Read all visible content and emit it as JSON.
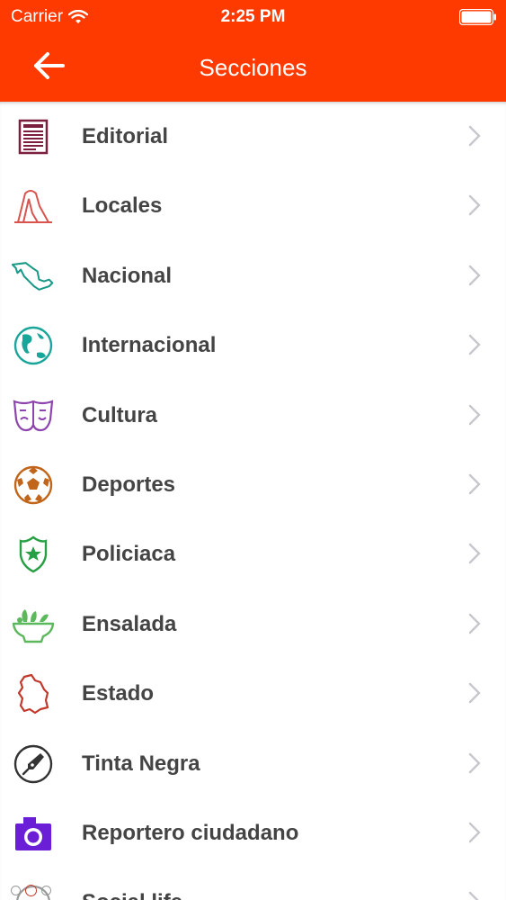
{
  "status_bar": {
    "carrier": "Carrier",
    "time": "2:25 PM"
  },
  "nav": {
    "title": "Secciones",
    "back_icon": "arrow-left-icon"
  },
  "colors": {
    "header_bg": "#fe3a00",
    "label": "#444444",
    "chevron": "#c7c7cc"
  },
  "sections": [
    {
      "label": "Editorial",
      "icon": "newspaper-icon",
      "color": "#7a1f3d"
    },
    {
      "label": "Locales",
      "icon": "monument-icon",
      "color": "#d9534f"
    },
    {
      "label": "Nacional",
      "icon": "mexico-map-icon",
      "color": "#1a9988"
    },
    {
      "label": "Internacional",
      "icon": "globe-icon",
      "color": "#1aa59a"
    },
    {
      "label": "Cultura",
      "icon": "theater-masks-icon",
      "color": "#8e44ad"
    },
    {
      "label": "Deportes",
      "icon": "soccer-ball-icon",
      "color": "#c0651a"
    },
    {
      "label": "Policiaca",
      "icon": "police-badge-icon",
      "color": "#27a045"
    },
    {
      "label": "Ensalada",
      "icon": "salad-bowl-icon",
      "color": "#5cb85c"
    },
    {
      "label": "Estado",
      "icon": "state-map-icon",
      "color": "#c0392b"
    },
    {
      "label": "Tinta Negra",
      "icon": "pen-nib-icon",
      "color": "#333333"
    },
    {
      "label": "Reportero ciudadano",
      "icon": "camera-icon",
      "color": "#6a1fd6"
    },
    {
      "label": "Social life",
      "icon": "social-icon",
      "color": "#999999"
    }
  ]
}
